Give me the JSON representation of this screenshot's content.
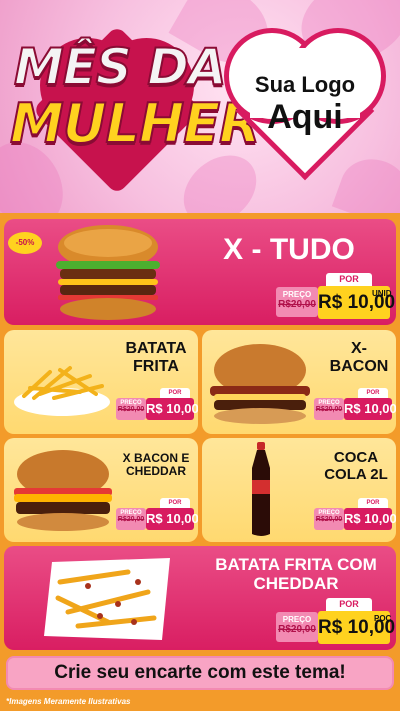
{
  "header": {
    "title_line1": "MÊS DA",
    "title_line2": "MULHER",
    "logo_line1": "Sua Logo",
    "logo_line2": "Aqui"
  },
  "discount_badge": "-50%",
  "products": [
    {
      "name": "X - TUDO",
      "por": "POR",
      "preco_label": "PREÇO",
      "old_price": "R$20,00",
      "new_price": "R$ 10,00",
      "unit": "UNID"
    },
    {
      "name": "BATATA FRITA",
      "por": "POR",
      "preco_label": "PREÇO",
      "old_price": "R$20,00",
      "new_price": "R$ 10,00"
    },
    {
      "name": "X- BACON",
      "por": "POR",
      "preco_label": "PREÇO",
      "old_price": "R$20,00",
      "new_price": "R$ 10,00"
    },
    {
      "name": "X BACON E CHEDDAR",
      "por": "POR",
      "preco_label": "PREÇO",
      "old_price": "R$20,00",
      "new_price": "R$ 10,00"
    },
    {
      "name": "COCA COLA 2L",
      "por": "POR",
      "preco_label": "PREÇO",
      "old_price": "R$20,00",
      "new_price": "R$ 10,00"
    },
    {
      "name": "BATATA FRITA COM CHEDDAR",
      "por": "POR",
      "preco_label": "PREÇO",
      "old_price": "R$20,00",
      "new_price": "R$ 10,00",
      "unit": "POÇ"
    }
  ],
  "cta": "Crie seu encarte com este tema!",
  "footnote": "*Imagens Meramente Ilustrativas",
  "colors": {
    "pink": "#d91e62",
    "yellow": "#ffd970",
    "orange": "#f39b2a",
    "gold": "#ffd21f"
  }
}
